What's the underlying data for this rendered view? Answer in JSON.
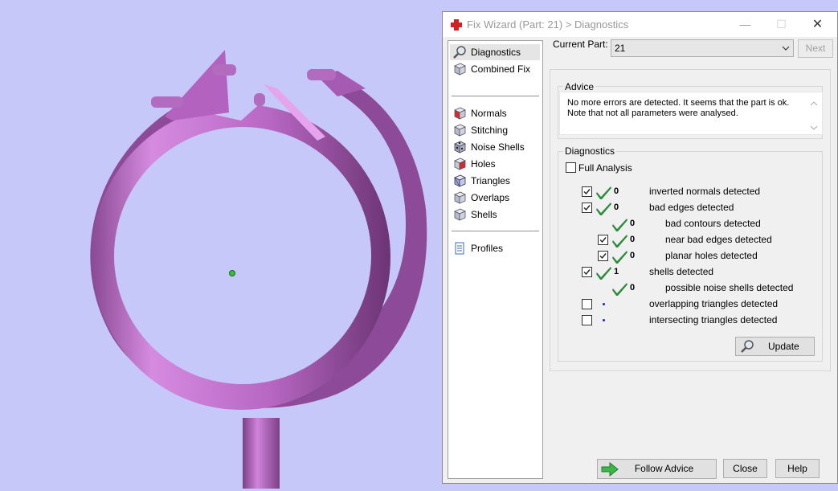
{
  "dialog": {
    "title": "Fix Wizard (Part: 21) > Diagnostics",
    "minimize_glyph": "—",
    "maximize_glyph": "☐",
    "close_glyph": "✕"
  },
  "nav": {
    "items": [
      {
        "label": "Diagnostics",
        "icon": "magnifier-icon",
        "selected": true
      },
      {
        "label": "Combined Fix",
        "icon": "cube-icon"
      },
      {
        "label": "Normals",
        "icon": "cube-red-icon"
      },
      {
        "label": "Stitching",
        "icon": "cube-icon"
      },
      {
        "label": "Noise Shells",
        "icon": "noise-shells-icon"
      },
      {
        "label": "Holes",
        "icon": "cube-red-icon"
      },
      {
        "label": "Triangles",
        "icon": "cube-blue-icon"
      },
      {
        "label": "Overlaps",
        "icon": "cube-icon"
      },
      {
        "label": "Shells",
        "icon": "cube-icon"
      },
      {
        "label": "Profiles",
        "icon": "document-icon"
      }
    ]
  },
  "current_part": {
    "label": "Current Part:",
    "value": "21",
    "next_label": "Next"
  },
  "advice": {
    "title": "Advice",
    "text": "No more errors are detected. It seems that the part is ok.\nNote that not all parameters were analysed."
  },
  "diagnostics": {
    "title": "Diagnostics",
    "full_analysis": {
      "label": "Full Analysis",
      "checked": false
    },
    "rows": [
      {
        "count": "0",
        "label": "inverted normals detected",
        "checkbox": true,
        "checked": true,
        "status": "ok",
        "indent": 0
      },
      {
        "count": "0",
        "label": "bad edges detected",
        "checkbox": true,
        "checked": true,
        "status": "ok",
        "indent": 0
      },
      {
        "count": "0",
        "label": "bad contours detected",
        "checkbox": false,
        "checked": false,
        "status": "ok",
        "indent": 1
      },
      {
        "count": "0",
        "label": "near bad edges detected",
        "checkbox": true,
        "checked": true,
        "status": "ok",
        "indent": 1
      },
      {
        "count": "0",
        "label": "planar holes detected",
        "checkbox": true,
        "checked": true,
        "status": "ok",
        "indent": 1
      },
      {
        "count": "1",
        "label": "shells detected",
        "checkbox": true,
        "checked": true,
        "status": "ok",
        "indent": 0
      },
      {
        "count": "0",
        "label": "possible noise shells detected",
        "checkbox": false,
        "checked": false,
        "status": "ok",
        "indent": 1
      },
      {
        "count": "",
        "label": "overlapping triangles detected",
        "checkbox": true,
        "checked": false,
        "status": "pending",
        "indent": 0
      },
      {
        "count": "",
        "label": "intersecting triangles detected",
        "checkbox": true,
        "checked": false,
        "status": "pending",
        "indent": 0
      }
    ],
    "update_label": "Update"
  },
  "footer": {
    "follow_advice": "Follow Advice",
    "close": "Close",
    "help": "Help"
  },
  "colors": {
    "background": "#c6c8f9",
    "model": "#c070c8",
    "check_green": "#2e8b3c",
    "pending_dot": "#2020c0"
  }
}
